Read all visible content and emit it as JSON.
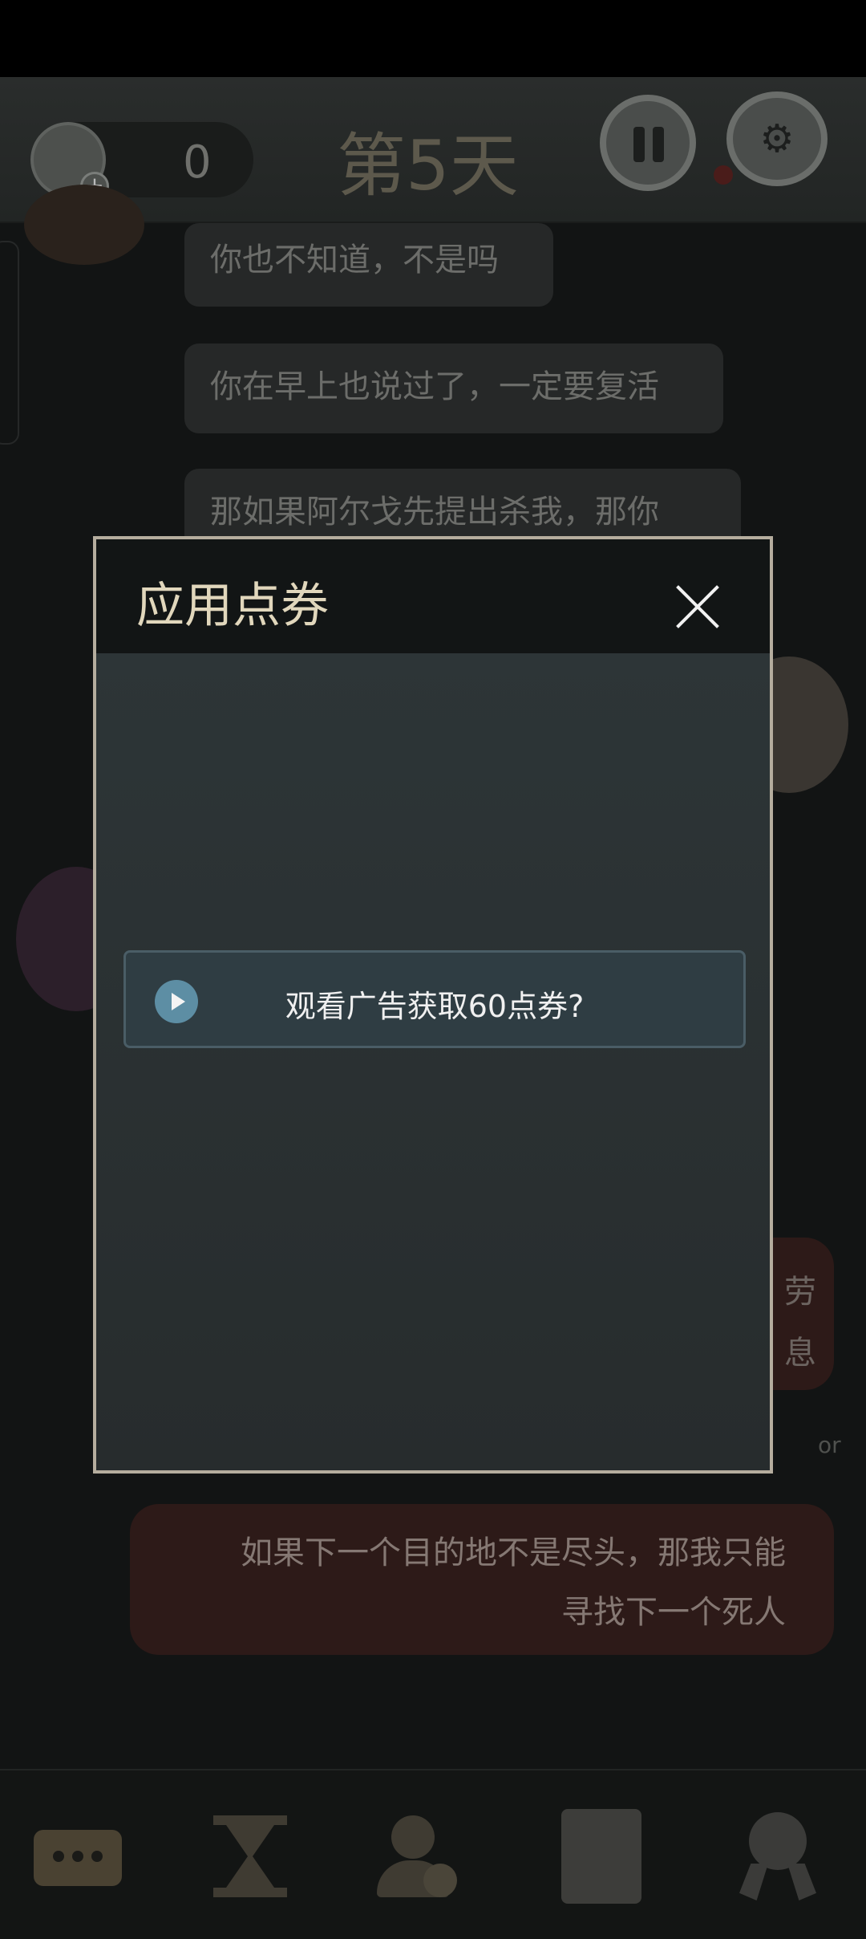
{
  "header": {
    "ticket_count": "0",
    "day_title": "第5天"
  },
  "chat": {
    "messages_left": [
      "你也不知道，不是吗",
      "你在早上也说过了，一定要复活",
      "那如果阿尔戈先提出杀我，那你"
    ],
    "partial_right": [
      "劳",
      "息"
    ],
    "or_label": "or",
    "message_right": {
      "line1": "如果下一个目的地不是尽头，那我只能",
      "line2": "寻找下一个死人"
    }
  },
  "modal": {
    "title": "应用点券",
    "ad_button_label": "观看广告获取60点券?"
  },
  "bottom_nav": {
    "items": [
      "chat-icon",
      "hourglass-icon",
      "add-character-icon",
      "book-icon",
      "award-icon"
    ]
  },
  "colors": {
    "modal_border": "#b5ad9e",
    "title_text": "#e1d7bc",
    "play_icon": "#5d8ea4",
    "ad_button_bg": "#2f3d43"
  }
}
